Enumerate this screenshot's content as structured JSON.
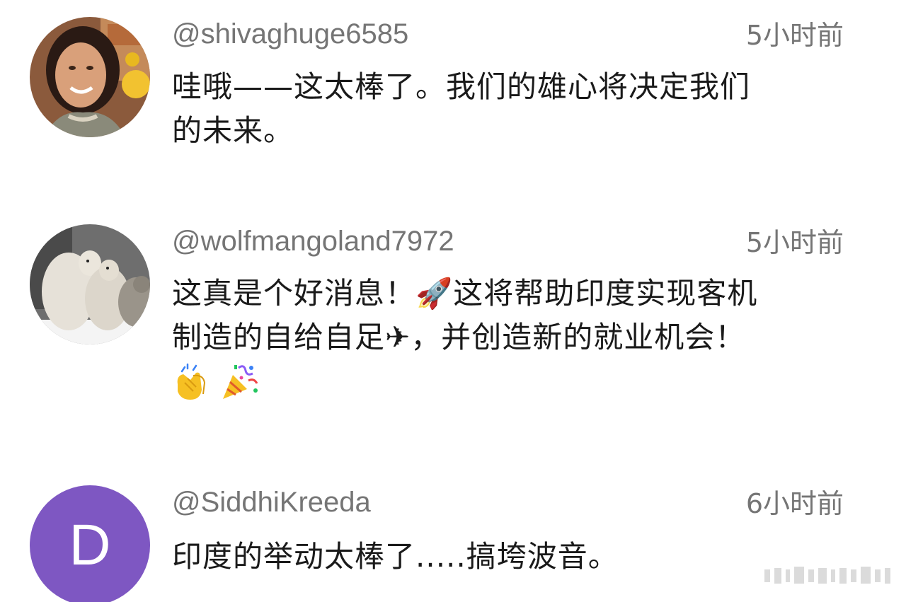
{
  "comments": [
    {
      "handle": "@shivaghuge6585",
      "time": "5小时前",
      "text_lines": [
        "哇哦——这太棒了。我们的雄心将决定我们",
        "的未来。"
      ],
      "avatar": {
        "type": "photo",
        "icon": "user-photo-woman"
      }
    },
    {
      "handle": "@wolfmangoland7972",
      "time": "5小时前",
      "text_lines": [
        "这真是个好消息！🚀这将帮助印度实现客机",
        "制造的自给自足✈，并创造新的就业机会！"
      ],
      "emoji_line": [
        "clapping-hands-icon",
        "party-popper-icon"
      ],
      "avatar": {
        "type": "photo",
        "icon": "wolves-photo"
      }
    },
    {
      "handle": "@SiddhiKreeda",
      "time": "6小时前",
      "text_lines": [
        "印度的举动太棒了.....搞垮波音。"
      ],
      "avatar": {
        "type": "letter",
        "letter": "D",
        "color": "#7e57c2"
      }
    }
  ],
  "colors": {
    "secondary_text": "#757575",
    "primary_text": "#1a1a1a",
    "background": "#ffffff"
  }
}
